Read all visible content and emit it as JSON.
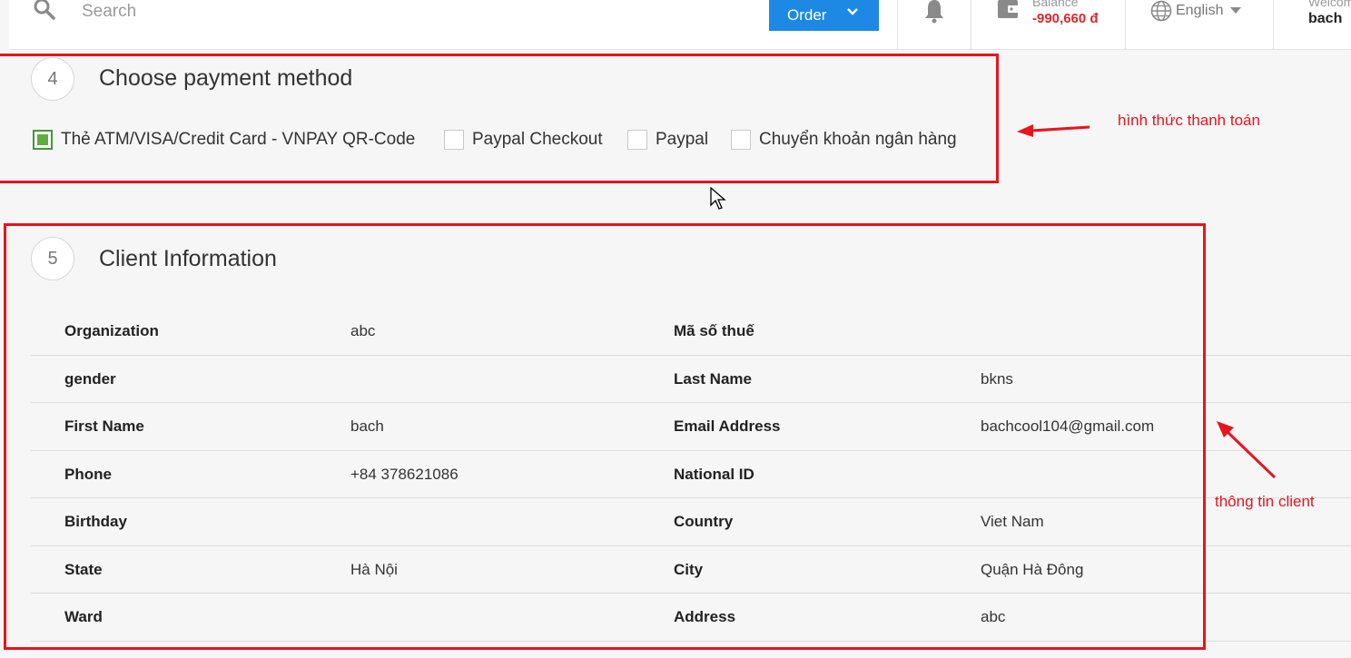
{
  "header": {
    "search_placeholder": "Search",
    "order_label": "Order",
    "balance_label": "Balance",
    "balance_value": "-990,660 đ",
    "language": "English",
    "welcome_label": "Welcome",
    "username": "bach"
  },
  "payment": {
    "step": "4",
    "title": "Choose payment method",
    "options": [
      {
        "label": "Thẻ ATM/VISA/Credit Card - VNPAY QR-Code",
        "checked": true
      },
      {
        "label": "Paypal Checkout",
        "checked": false
      },
      {
        "label": "Paypal",
        "checked": false
      },
      {
        "label": "Chuyển khoản ngân hàng",
        "checked": false
      }
    ]
  },
  "client": {
    "step": "5",
    "title": "Client Information",
    "rows": [
      {
        "l1": "Organization",
        "v1": "abc",
        "l2": "Mã số thuế",
        "v2": ""
      },
      {
        "l1": "gender",
        "v1": "",
        "l2": "Last Name",
        "v2": "bkns"
      },
      {
        "l1": "First Name",
        "v1": "bach",
        "l2": "Email Address",
        "v2": "bachcool104@gmail.com"
      },
      {
        "l1": "Phone",
        "v1": "+84 378621086",
        "l2": "National ID",
        "v2": ""
      },
      {
        "l1": "Birthday",
        "v1": "",
        "l2": "Country",
        "v2": "Viet Nam"
      },
      {
        "l1": "State",
        "v1": "Hà Nội",
        "l2": "City",
        "v2": "Quận Hà Đông"
      },
      {
        "l1": "Ward",
        "v1": "",
        "l2": "Address",
        "v2": "abc"
      }
    ]
  },
  "annotations": {
    "payment_note": "hình thức thanh toán",
    "client_note": "thông tin client"
  },
  "colors": {
    "accent": "#1e88e5",
    "annotation": "#e8141c",
    "balance": "#e0262b",
    "checked": "#5fae3c"
  }
}
